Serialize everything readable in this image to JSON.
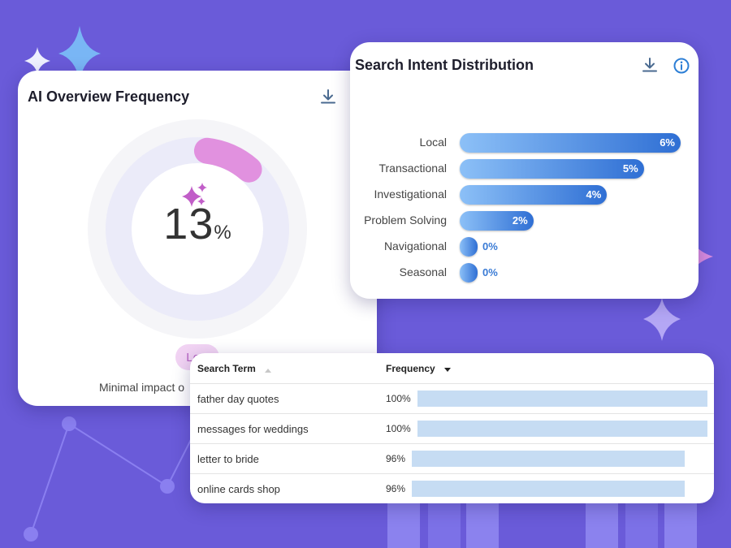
{
  "ai_overview": {
    "title": "AI Overview Frequency",
    "value": "13",
    "unit": "%",
    "fraction": 0.13,
    "badge": "Low",
    "description": "Minimal impact o",
    "download_icon": "download-icon",
    "colors": {
      "arc": "#e191df",
      "ring": "#ebebf9",
      "outer": "#f5f5f8",
      "badge_bg": "#f1d3f3",
      "badge_text": "#b563c1"
    }
  },
  "search_intent": {
    "title": "Search Intent Distribution",
    "download_icon": "download-icon",
    "info_icon": "info-icon",
    "items": [
      {
        "label": "Local",
        "value": "6%",
        "fraction": 0.06
      },
      {
        "label": "Transactional",
        "value": "5%",
        "fraction": 0.05
      },
      {
        "label": "Investigational",
        "value": "4%",
        "fraction": 0.04
      },
      {
        "label": "Problem Solving",
        "value": "2%",
        "fraction": 0.02
      },
      {
        "label": "Navigational",
        "value": "0%",
        "fraction": 0.0
      },
      {
        "label": "Seasonal",
        "value": "0%",
        "fraction": 0.0
      }
    ],
    "colors": {
      "bar_start": "#8cc0f7",
      "bar_end": "#2f6fd4"
    }
  },
  "search_terms": {
    "columns": {
      "term": "Search Term",
      "frequency": "Frequency"
    },
    "sort_icons": {
      "term": "sort-up-icon",
      "frequency": "sort-down-icon"
    },
    "rows": [
      {
        "term": "father day quotes",
        "frequency": "100%",
        "fraction": 1.0
      },
      {
        "term": "messages for weddings",
        "frequency": "100%",
        "fraction": 1.0
      },
      {
        "term": "letter to bride",
        "frequency": "96%",
        "fraction": 0.96
      },
      {
        "term": "online cards shop",
        "frequency": "96%",
        "fraction": 0.96
      }
    ],
    "colors": {
      "bar": "#c6dcf3"
    }
  },
  "background": {
    "color": "#6a5bd9"
  }
}
